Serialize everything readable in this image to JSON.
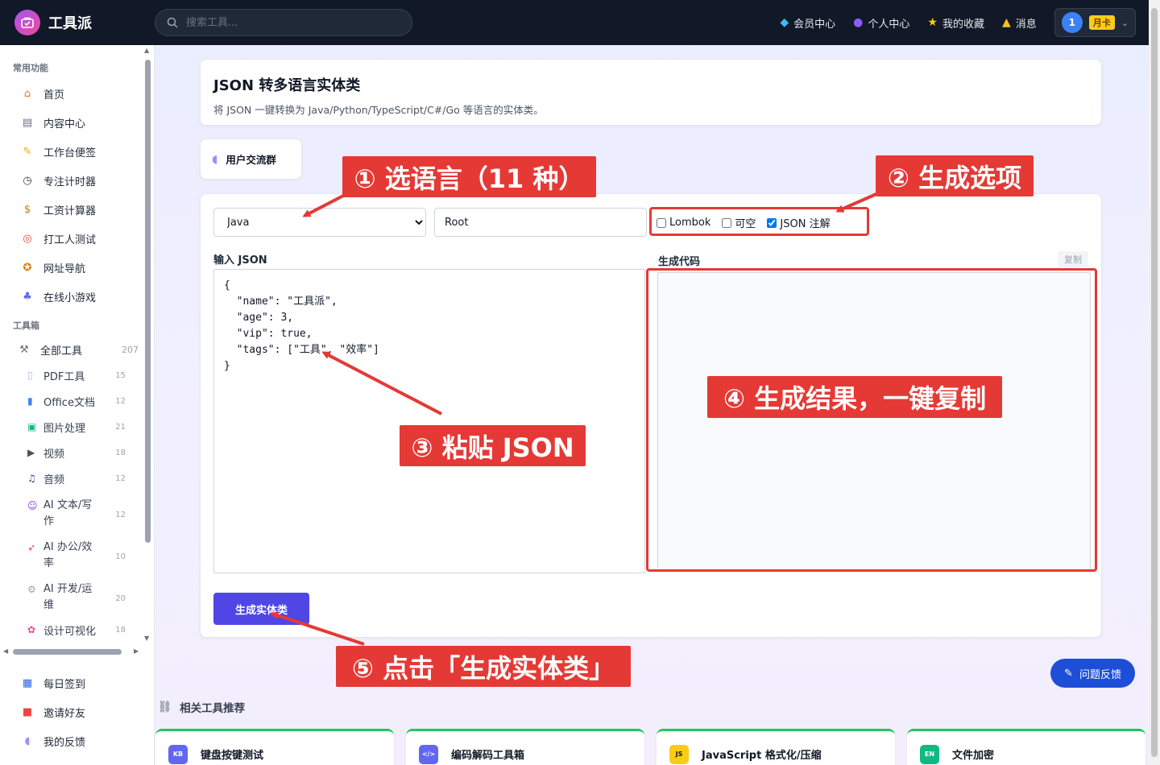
{
  "header": {
    "brand": "工具派",
    "search_placeholder": "搜索工具...",
    "nav": [
      {
        "label": "会员中心",
        "icon": "diamond-icon"
      },
      {
        "label": "个人中心",
        "icon": "user-icon"
      },
      {
        "label": "我的收藏",
        "icon": "star-icon"
      },
      {
        "label": "消息",
        "icon": "bell-icon"
      }
    ],
    "avatar_text": "1",
    "plan_badge": "月卡"
  },
  "sidebar": {
    "section_common": "常用功能",
    "common": [
      "首页",
      "内容中心",
      "工作台便签",
      "专注计时器",
      "工资计算器",
      "打工人测试",
      "网址导航",
      "在线小游戏"
    ],
    "section_tools": "工具箱",
    "all_tools": {
      "label": "全部工具",
      "count": "207"
    },
    "categories": [
      {
        "label": "PDF工具",
        "count": "15"
      },
      {
        "label": "Office文档",
        "count": "12"
      },
      {
        "label": "图片处理",
        "count": "21"
      },
      {
        "label": "视频",
        "count": "18"
      },
      {
        "label": "音频",
        "count": "12"
      },
      {
        "label": "AI 文本/写作",
        "count": "12"
      },
      {
        "label": "AI 办公/效率",
        "count": "10"
      },
      {
        "label": "AI 开发/运维",
        "count": "20"
      },
      {
        "label": "设计可视化",
        "count": "18"
      }
    ],
    "bottom": [
      "每日签到",
      "邀请好友",
      "我的反馈"
    ]
  },
  "page": {
    "title": "JSON 转多语言实体类",
    "subtitle": "将 JSON 一键转换为 Java/Python/TypeScript/C#/Go 等语言的实体类。",
    "group": "用户交流群"
  },
  "tool": {
    "language": "Java",
    "class_name": "Root",
    "options": [
      {
        "label": "Lombok",
        "checked": false
      },
      {
        "label": "可空",
        "checked": false
      },
      {
        "label": "JSON 注解",
        "checked": true
      }
    ],
    "input_label": "输入 JSON",
    "output_label": "生成代码",
    "copy_label": "复制",
    "input_json": "{\n  \"name\": \"工具派\",\n  \"age\": 3,\n  \"vip\": true,\n  \"tags\": [\"工具\", \"效率\"]\n}",
    "generate_label": "生成实体类"
  },
  "annotations": {
    "a1": "① 选语言（11 种）",
    "a2": "② 生成选项",
    "a3": "③ 粘贴 JSON",
    "a4": "④ 生成结果，一键复制",
    "a5": "⑤ 点击「生成实体类」",
    "color": "#e53935"
  },
  "related": {
    "title": "相关工具推荐",
    "items": [
      {
        "label": "键盘按键测试",
        "badge": "KB"
      },
      {
        "label": "编码解码工具箱",
        "badge": "</>"
      },
      {
        "label": "JavaScript 格式化/压缩",
        "badge": "JS"
      },
      {
        "label": "文件加密",
        "badge": "EN"
      }
    ]
  },
  "feedback_label": "问题反馈"
}
